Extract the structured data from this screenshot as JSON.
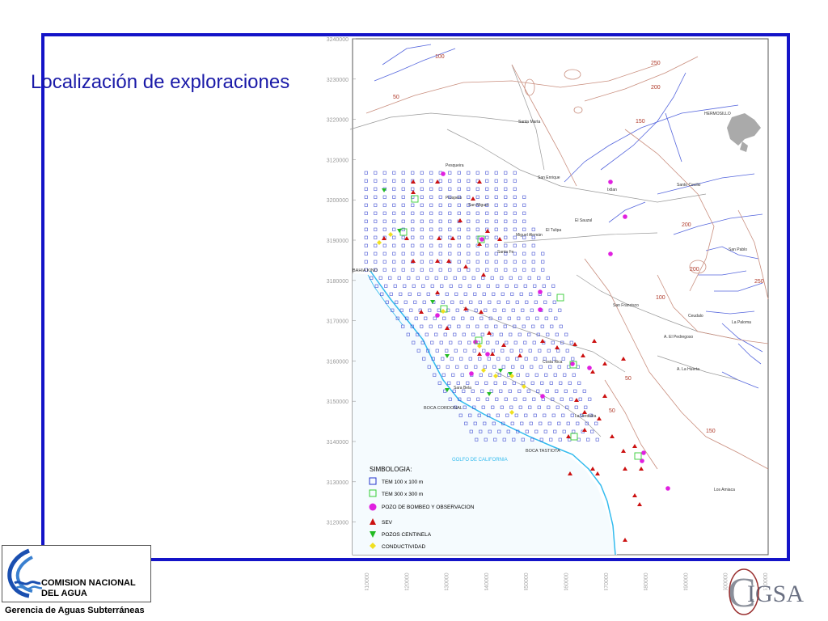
{
  "slide": {
    "title": "Localización de exploraciones",
    "footer_org_line1": "COMISION NACIONAL",
    "footer_org_line2": "DEL  AGUA",
    "footer_subtitle": "Gerencia de Aguas Subterráneas",
    "partner_logo_text": "CIGSA"
  },
  "map": {
    "y_ticks": [
      "3240000",
      "3230000",
      "3220000",
      "3120000",
      "3200000",
      "3190000",
      "3180000",
      "3170000",
      "3160000",
      "3150000",
      "3140000",
      "3130000",
      "3120000"
    ],
    "x_ticks": [
      "410000",
      "420000",
      "430000",
      "440000",
      "450000",
      "460000",
      "470000",
      "480000",
      "490000",
      "500000",
      "510000"
    ],
    "contour_labels": [
      "100",
      "250",
      "200",
      "150",
      "50",
      "100",
      "50",
      "150",
      "200",
      "250",
      "200",
      "50"
    ],
    "places": [
      {
        "label": "HERMOSILLO"
      },
      {
        "label": "BAHIA KINO"
      },
      {
        "label": "BOCA CORDONAL"
      },
      {
        "label": "BOCA TASTIOTA"
      },
      {
        "label": "GOLFO DE CALIFORNIA"
      },
      {
        "label": "San Pablo"
      },
      {
        "label": "La Paloma"
      },
      {
        "label": "Los Amiaca"
      },
      {
        "label": "A. La Huerta"
      },
      {
        "label": "A. El Pedregoso"
      },
      {
        "label": "Ceudalo"
      },
      {
        "label": "San Enrique"
      },
      {
        "label": "Santo Cecilio"
      },
      {
        "label": "El Sauzal"
      },
      {
        "label": "Pesqueira"
      },
      {
        "label": "San Miguel"
      },
      {
        "label": "Ixtlan"
      },
      {
        "label": "El Tulipa"
      },
      {
        "label": "Miguel Alemán"
      },
      {
        "label": "Santa Fe"
      },
      {
        "label": "San Francisco"
      },
      {
        "label": "Santa Marta"
      },
      {
        "label": "Prospero"
      },
      {
        "label": "Costa Rica"
      },
      {
        "label": "Sara Bela"
      },
      {
        "label": "La Verdolita"
      }
    ],
    "legend": {
      "title": "SIMBOLOGIA:",
      "items": [
        {
          "label": "TEM 100 x 100 m",
          "symbol": "square",
          "color": "#2233cc"
        },
        {
          "label": "TEM 300 x 300 m",
          "symbol": "square",
          "color": "#33cc33"
        },
        {
          "label": "POZO DE BOMBEO Y OBSERVACION",
          "symbol": "circle",
          "color": "#e020e0"
        },
        {
          "label": "SEV",
          "symbol": "triangle-up",
          "color": "#cc1111"
        },
        {
          "label": "POZOS CENTINELA",
          "symbol": "triangle-down",
          "color": "#22bb22"
        },
        {
          "label": "CONDUCTIVIDAD",
          "symbol": "diamond",
          "color": "#f0e020"
        }
      ]
    }
  }
}
